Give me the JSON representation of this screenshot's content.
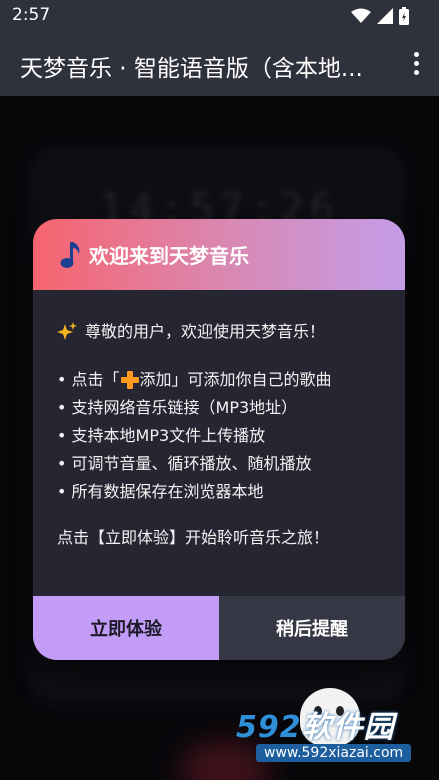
{
  "status_bar": {
    "time": "2:57",
    "icons": [
      "wifi-icon",
      "signal-icon",
      "battery-icon"
    ]
  },
  "app_bar": {
    "title": "天梦音乐 · 智能语音版（含本地...",
    "menu_icon": "more-vert-icon"
  },
  "background": {
    "clock_text": "14:57:26"
  },
  "dialog": {
    "title": "欢迎来到天梦音乐",
    "greeting": "尊敬的用户，欢迎使用天梦音乐！",
    "list": {
      "item1_prefix": "• 点击「",
      "item1_bracket_text": "添加",
      "item1_suffix": "」可添加你自己的歌曲",
      "item2": "• 支持网络音乐链接（MP3地址）",
      "item3": "• 支持本地MP3文件上传播放",
      "item4": "• 可调节音量、循环播放、随机播放",
      "item5": "• 所有数据保存在浏览器本地"
    },
    "closing": "点击【立即体验】开始聆听音乐之旅！",
    "buttons": {
      "primary": "立即体验",
      "secondary": "稍后提醒"
    }
  },
  "watermark": {
    "logo_num": "592",
    "logo_text": "软件园",
    "url": "www.592xiazai.com"
  },
  "colors": {
    "header_gradient_start": "#f7646e",
    "header_gradient_end": "#c59ce8",
    "primary_button": "#c39cf7",
    "dialog_bg": "#262633",
    "appbar_bg": "#2f313d"
  }
}
